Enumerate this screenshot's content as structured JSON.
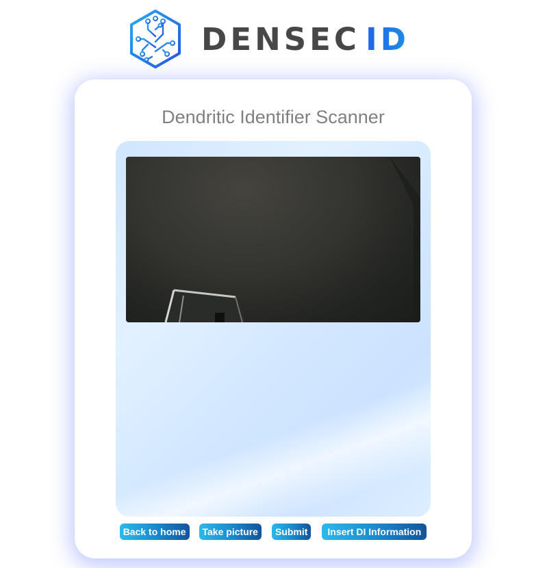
{
  "brand": {
    "logo_icon": "circuit-hexagon-icon",
    "name_main": "DENSEC",
    "name_accent": "ID",
    "accent_color": "#1f78e6",
    "text_color": "#474747"
  },
  "scanner": {
    "title": "Dendritic Identifier Scanner",
    "feed": "live-camera-feed"
  },
  "actions": {
    "back_home": "Back to home",
    "take_picture": "Take picture",
    "submit": "Submit",
    "insert_di": "Insert DI Information"
  }
}
